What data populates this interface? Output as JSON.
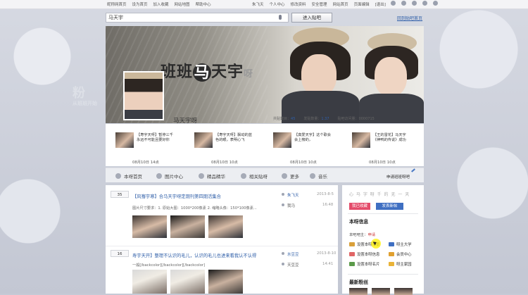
{
  "topnav": {
    "left_links": [
      "昵称网首页",
      "设为首页",
      "加入收藏",
      "网站地图",
      "帮助中心"
    ],
    "right_links": [
      "朱飞天",
      "个人中心",
      "修改资料",
      "安全管理",
      "网站首页",
      "页面编辑",
      "[退出]"
    ]
  },
  "search": {
    "value": "马天宇",
    "button": "进入贴吧",
    "back_link": "回到贴吧首页"
  },
  "banner": {
    "title_prefix": "班班",
    "title_circle": "马",
    "title_main": "天宇",
    "title_suffix": "呀"
  },
  "bar": {
    "name": "马天宇呀",
    "stats": [
      {
        "label": "共贴数目：",
        "value": "45"
      },
      {
        "label": "发贴数量：",
        "value": "1.37"
      },
      {
        "label": "贴吧访问量：",
        "value": "0000715"
      }
    ]
  },
  "feed": [
    {
      "text": "【寿宇天呀】暂停三千永远不可能且要好你",
      "date": "08月10日 14点"
    },
    {
      "text": "【寿宇天呀】飘动的蓝色的眼，表明心飞",
      "date": "08月10日 10点"
    },
    {
      "text": "【真爱天宇】这个歌会会上榜的，",
      "date": "08月10日 10点"
    },
    {
      "text": "【王的雷花】马天宇《神鸭的传说》成功",
      "date": "08月10日 10点"
    }
  ],
  "tabs": [
    "本呀首页",
    "图片中心",
    "精品精华",
    "相关贴呀",
    "更多",
    "音乐"
  ],
  "apply_link": "申请班班呀吧",
  "posts": [
    {
      "count": "35",
      "title": "【风骞宇寒】合马天宇呀定期刊第四期活集合",
      "excerpt": "图片尺寸要求：1. 原始大图：1000*200像素 2. 缩略头像：150*100像素...",
      "author": "朱飞天",
      "replier": "我马",
      "date": "2013-8-5",
      "time": "16:48"
    },
    {
      "count": "16",
      "title": "寿宇天开】整理不认识的毛儿，认识的毛儿也进来看我认不认得",
      "excerpt": "一般[/backcolor][/backcolor][/backcolor]",
      "author": "水豆豆",
      "replier": "天豆豆",
      "date": "2013-8-10",
      "time": "14:41"
    }
  ],
  "side": {
    "slogan": "心  马  字  呀  千  的  无  一  天",
    "fav_button": "我已收藏",
    "share_button": "发表新帖",
    "info_heading": "本呀信息",
    "owner_label": "本吧吧主：",
    "owner_apply": "申请",
    "grid": [
      {
        "label": "设置本呀背景",
        "color": "#d9a03a"
      },
      {
        "label": "呀主大学",
        "color": "#3f6fc2"
      },
      {
        "label": "设置本呀信息",
        "color": "#e06666"
      },
      {
        "label": "会员中心",
        "color": "#e0a030"
      },
      {
        "label": "设置本呀名片",
        "color": "#5b9a4a"
      },
      {
        "label": "呀主家园",
        "color": "#e9b338"
      }
    ],
    "new_fans_heading": "最新粉丝"
  },
  "fan_mark": {
    "big": "粉",
    "small": "从班班开始"
  },
  "colors": {
    "accent": "#2e5ea8",
    "red_btn": "#e44b6a",
    "blue_btn": "#3f6fc2"
  }
}
